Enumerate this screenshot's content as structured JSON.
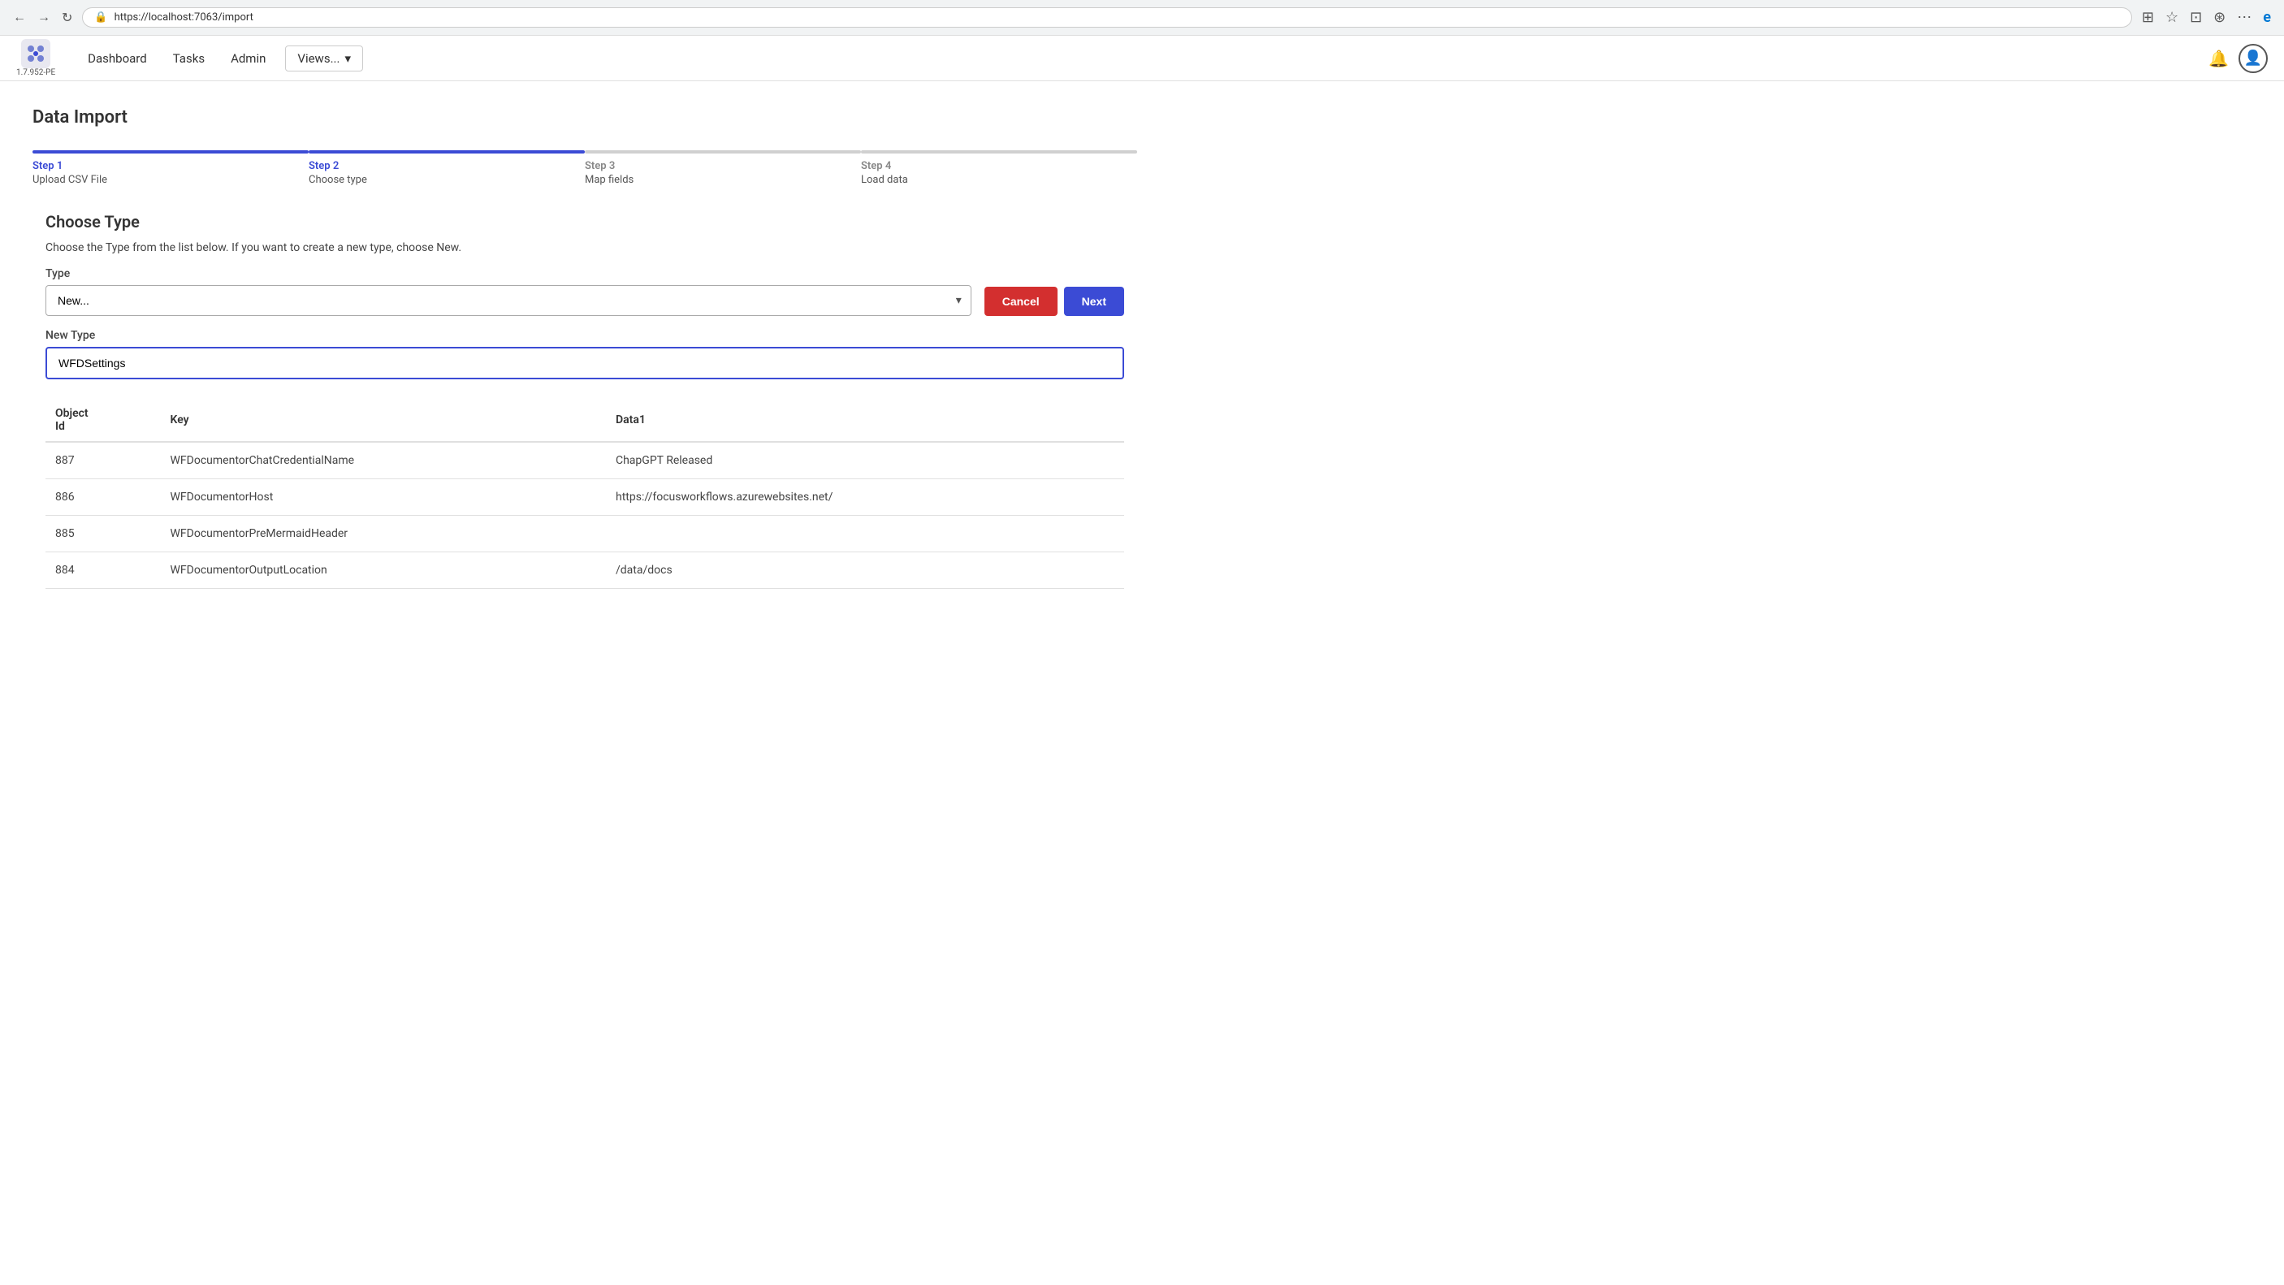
{
  "browser": {
    "url": "https://localhost:7063/import",
    "back_icon": "←",
    "forward_icon": "→",
    "refresh_icon": "↻",
    "lock_icon": "🔒"
  },
  "app": {
    "version": "1.7.952-PE",
    "nav": {
      "dashboard": "Dashboard",
      "tasks": "Tasks",
      "admin": "Admin",
      "views": "Views..."
    }
  },
  "page": {
    "title": "Data Import"
  },
  "steps": [
    {
      "label": "Step 1",
      "sublabel": "Upload CSV File",
      "active": true
    },
    {
      "label": "Step 2",
      "sublabel": "Choose type",
      "active": true
    },
    {
      "label": "Step 3",
      "sublabel": "Map fields",
      "active": false
    },
    {
      "label": "Step 4",
      "sublabel": "Load data",
      "active": false
    }
  ],
  "choose_type": {
    "title": "Choose Type",
    "description": "Choose the Type from the list below. If you want to create a new type, choose New.",
    "type_label": "Type",
    "type_placeholder": "New...",
    "new_type_label": "New Type",
    "new_type_value": "WFDSettings",
    "cancel_label": "Cancel",
    "next_label": "Next"
  },
  "table": {
    "columns": [
      {
        "key": "object_id",
        "label": "Object Id"
      },
      {
        "key": "key",
        "label": "Key"
      },
      {
        "key": "data1",
        "label": "Data1"
      }
    ],
    "rows": [
      {
        "object_id": "887",
        "key": "WFDocumentorChatCredentialName",
        "data1": "ChapGPT Released"
      },
      {
        "object_id": "886",
        "key": "WFDocumentorHost",
        "data1": "https://focusworkflows.azurewebsites.net/"
      },
      {
        "object_id": "885",
        "key": "WFDocumentorPreMermaidHeader",
        "data1": ""
      },
      {
        "object_id": "884",
        "key": "WFDocumentorOutputLocation",
        "data1": "/data/docs"
      }
    ]
  }
}
